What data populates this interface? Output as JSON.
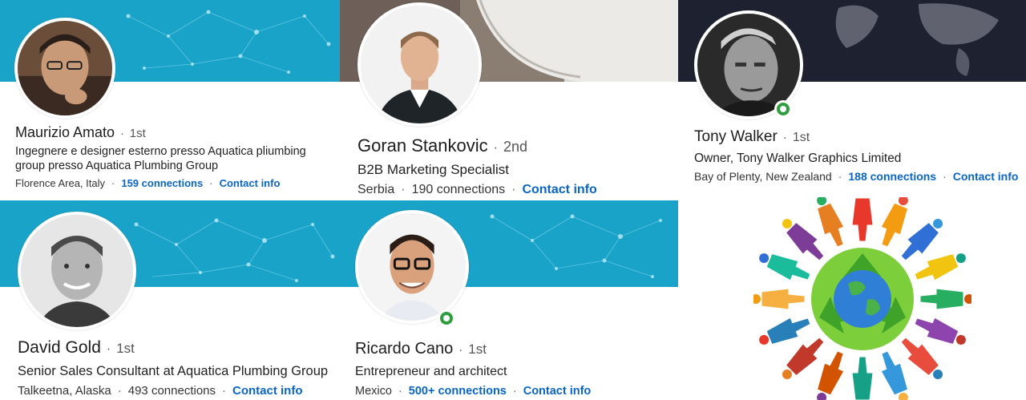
{
  "profiles": [
    {
      "name": "Maurizio Amato",
      "degree": "1st",
      "headline": "Ingegnere e designer esterno presso Aquatica pliumbing group presso Aquatica Plumbing Group",
      "location": "Florence Area, Italy",
      "connections": "159 connections",
      "contact": "Contact info",
      "online": false
    },
    {
      "name": "Goran Stankovic",
      "degree": "2nd",
      "headline": "B2B Marketing Specialist",
      "location": "Serbia",
      "connections": "190 connections",
      "contact": "Contact info",
      "online": false
    },
    {
      "name": "Tony Walker",
      "degree": "1st",
      "headline": "Owner, Tony Walker Graphics Limited",
      "location": "Bay of Plenty, New Zealand",
      "connections": "188 connections",
      "contact": "Contact info",
      "online": true
    },
    {
      "name": "David Gold",
      "degree": "1st",
      "headline": "Senior Sales Consultant at Aquatica Plumbing Group",
      "location": "Talkeetna, Alaska",
      "connections": "493 connections",
      "contact": "Contact info",
      "online": false
    },
    {
      "name": "Ricardo Cano",
      "degree": "1st",
      "headline": "Entrepreneur and architect",
      "location": "Mexico",
      "connections": "500+ connections",
      "contact": "Contact info",
      "online": true
    }
  ],
  "separator": "·",
  "colors": {
    "banner_blue": "#1aa3c9",
    "link_blue": "#0a66c2",
    "online_green": "#2e9e3f"
  },
  "icons": {
    "online_status": "online-status-icon",
    "recycle_globe": "recycle-globe-people-icon"
  }
}
